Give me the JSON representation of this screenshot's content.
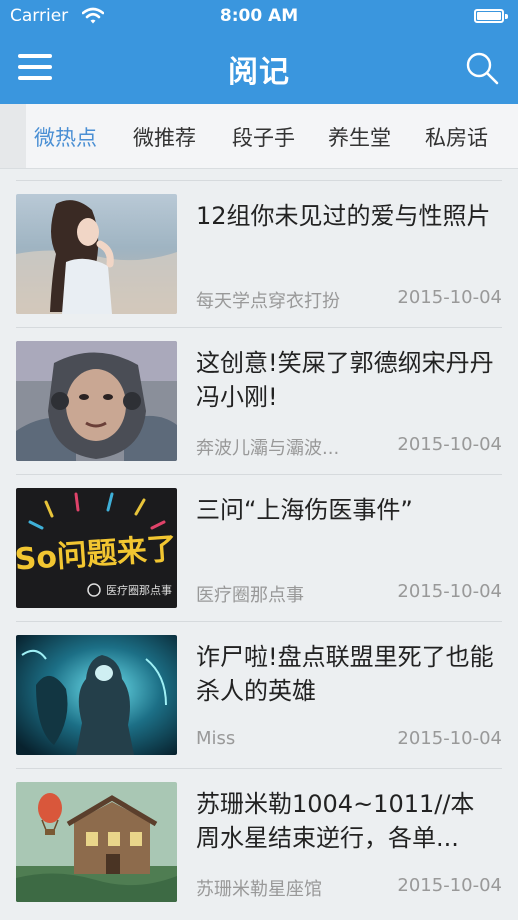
{
  "status_bar": {
    "carrier": "Carrier",
    "time": "8:00 AM"
  },
  "nav": {
    "title": "阅记",
    "menu_icon": "menu-icon",
    "search_icon": "search-icon"
  },
  "tabs": [
    {
      "label": "微热点",
      "active": true
    },
    {
      "label": "微推荐",
      "active": false
    },
    {
      "label": "段子手",
      "active": false
    },
    {
      "label": "养生堂",
      "active": false
    },
    {
      "label": "私房话",
      "active": false
    }
  ],
  "colors": {
    "header": "#3a96de",
    "active_tab": "#4a8fd4",
    "meta_text": "#999999"
  },
  "articles": [
    {
      "title": "12组你未见过的爱与性照片",
      "source": "每天学点穿衣打扮",
      "date": "2015-10-04"
    },
    {
      "title": "这创意!笑屎了郭德纲宋丹丹冯小刚!",
      "source": "奔波儿灞与灞波...",
      "date": "2015-10-04"
    },
    {
      "title": "三问“上海伤医事件”",
      "source": "医疗圈那点事",
      "date": "2015-10-04",
      "thumb_text": "So问题来了",
      "thumb_caption": "医疗圈那点事"
    },
    {
      "title": "诈尸啦!盘点联盟里死了也能杀人的英雄",
      "source": "Miss",
      "date": "2015-10-04"
    },
    {
      "title": "苏珊米勒1004~1011//本周水星结束逆行，各单...",
      "source": "苏珊米勒星座馆",
      "date": "2015-10-04"
    }
  ]
}
